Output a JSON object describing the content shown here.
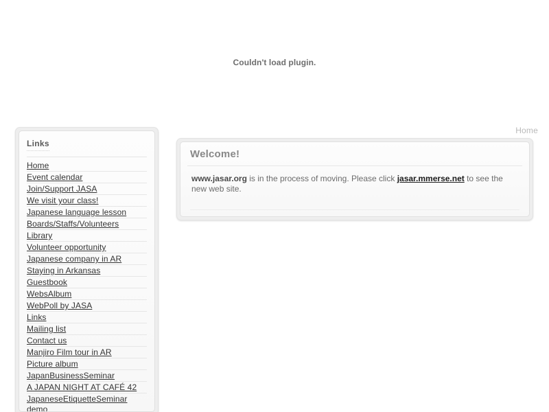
{
  "plugin": {
    "message": "Couldn't load plugin."
  },
  "topnav": {
    "home_label": "Home"
  },
  "sidebar": {
    "title": "Links",
    "items": [
      {
        "label": "Home"
      },
      {
        "label": "Event calendar"
      },
      {
        "label": "Join/Support JASA"
      },
      {
        "label": "We visit your class!"
      },
      {
        "label": "Japanese language lesson"
      },
      {
        "label": "Boards/Staffs/Volunteers"
      },
      {
        "label": "Library"
      },
      {
        "label": "Volunteer opportunity"
      },
      {
        "label": "Japanese company in AR"
      },
      {
        "label": "Staying in Arkansas"
      },
      {
        "label": "Guestbook"
      },
      {
        "label": "WebsAlbum"
      },
      {
        "label": "WebPoll by JASA"
      },
      {
        "label": "Links"
      },
      {
        "label": "Mailing list"
      },
      {
        "label": "Contact us"
      },
      {
        "label": "Manjiro Film tour in AR"
      },
      {
        "label": "Picture album"
      },
      {
        "label": "JapanBusinessSeminar"
      },
      {
        "label": "A JAPAN NIGHT AT CAFÉ 42"
      },
      {
        "label": "JapaneseEtiquetteSeminar demo"
      }
    ]
  },
  "welcome": {
    "title": "Welcome!",
    "text_bold_site": "www.jasar.org",
    "text_middle": " is in the process of moving. Please click ",
    "link_label": "jasar.mmerse.net",
    "text_end": " to see the new web site."
  },
  "colors": {
    "page_background": "#ffffff",
    "panel_outer": "#eeeeee",
    "panel_inner": "#fbfbfb",
    "body_text": "#6b6b6b",
    "heading_text": "#888888",
    "link_text": "#1c1c1c",
    "nav_text": "#b9b9b9"
  }
}
